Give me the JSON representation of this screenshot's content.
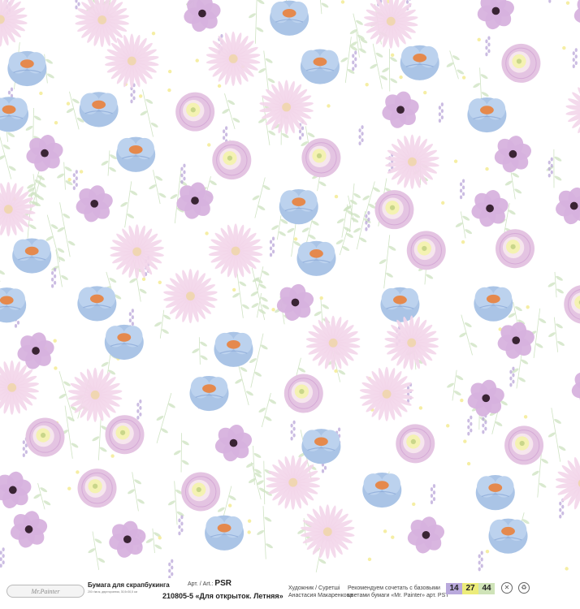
{
  "footer": {
    "logo": "Mr.Painter",
    "product_title": "Бумага для скрапбукинга",
    "fine_print": "200 г/кв.м, двусторонняя, 30,5×30,5 см",
    "art_label": "Арт. / Art.:",
    "art_code": "PSR",
    "design_name": "210805-5 «Для открыток. Летняя»",
    "artist_label": "Художник / Суретші",
    "artist_name": "Анастасия Макаренкова",
    "recommend_line1": "Рекомендуем сочетать с базовыми",
    "recommend_line2": "цветами бумаги «Mr. Painter» арт. PST",
    "swatches": [
      {
        "number": "14",
        "color": "#b9a9dc"
      },
      {
        "number": "27",
        "color": "#ecec7a"
      },
      {
        "number": "44",
        "color": "#cfe3b8"
      }
    ],
    "icons": [
      "no-water-icon",
      "recycle-icon"
    ]
  },
  "pattern": {
    "background": "#ffffff",
    "colors": {
      "blue_petal": "#aac4e6",
      "blue_dark": "#7f9fd2",
      "pink_petal": "#e4c4e2",
      "pink_dark": "#c890cc",
      "anemone_petal": "#d7b2de",
      "anemone_center": "#3a2434",
      "rose_center": "#f4f2b2",
      "daisy_petal": "#f3d6ea",
      "daisy_center": "#f0d6b2",
      "leaf": "#cfe3c3",
      "lavender": "#b9a6d8",
      "yellow_dot": "#f4ec9a",
      "orange_center": "#e5894d"
    }
  }
}
